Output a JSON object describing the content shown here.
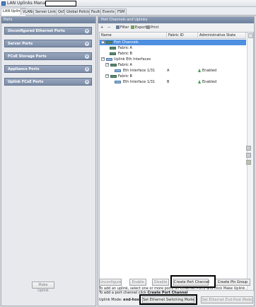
{
  "window": {
    "title": "LAN Uplinks Manager"
  },
  "tabs": [
    "LAN Uplinks",
    "VLANs",
    "Server Links",
    "QoS",
    "Global Policies",
    "Faults",
    "Events",
    "FSM"
  ],
  "left": {
    "header": "Ports",
    "items": [
      "Unconfigured Ethernet Ports",
      "Server Ports",
      "FCoE Storage Ports",
      "Appliance Ports",
      "Uplink FCoE Ports"
    ],
    "make_uplink": "Make Uplink"
  },
  "right": {
    "header": "Port Channels and Uplinks",
    "toolbar": {
      "add": "+",
      "remove": "−",
      "filter": "Filter",
      "export": "Export",
      "print": "Print"
    },
    "columns": [
      "Name",
      "Fabric ID",
      "Administrative State"
    ],
    "rows": [
      {
        "name": "Port Channels",
        "fabric": "",
        "state": "",
        "level": 0,
        "toggle": "−",
        "selected": true
      },
      {
        "name": "Fabric A",
        "fabric": "",
        "state": "",
        "level": 1,
        "toggle": "",
        "selected": false
      },
      {
        "name": "Fabric B",
        "fabric": "",
        "state": "",
        "level": 1,
        "toggle": "",
        "selected": false
      },
      {
        "name": "Uplink Eth Interfaces",
        "fabric": "",
        "state": "",
        "level": 0,
        "toggle": "−",
        "selected": false
      },
      {
        "name": "Fabric A",
        "fabric": "",
        "state": "",
        "level": 1,
        "toggle": "−",
        "selected": false
      },
      {
        "name": "Eth Interface 1/31",
        "fabric": "A",
        "state": "Enabled",
        "level": 2,
        "toggle": "",
        "selected": false
      },
      {
        "name": "Fabric B",
        "fabric": "",
        "state": "",
        "level": 1,
        "toggle": "−",
        "selected": false
      },
      {
        "name": "Eth Interface 1/31",
        "fabric": "B",
        "state": "Enabled",
        "level": 2,
        "toggle": "",
        "selected": false
      }
    ],
    "buttons": {
      "unconfigure": "Unconfigure",
      "enable": "Enable",
      "disable": "Disable",
      "create_port_channel": "Create Port Channel",
      "create_pin_group": "Create Pin Group"
    },
    "info_line1": "To add an uplink, select one or more ports on Ethernet Ports and click Make Uplink.",
    "info_line2_prefix": "To add a port channel click ",
    "info_line2_bold": "Create Port Channel",
    "uplink_mode_label": "Uplink Mode:",
    "uplink_mode_value": "end-host",
    "set_switching": "Set Ethernet Switching Mode",
    "set_end_host": "Set Ethernet End-Host Mode"
  },
  "colors": {
    "header": "#6c7f9b",
    "selection": "#4d8fe0",
    "enabled": "#3ea14a"
  }
}
